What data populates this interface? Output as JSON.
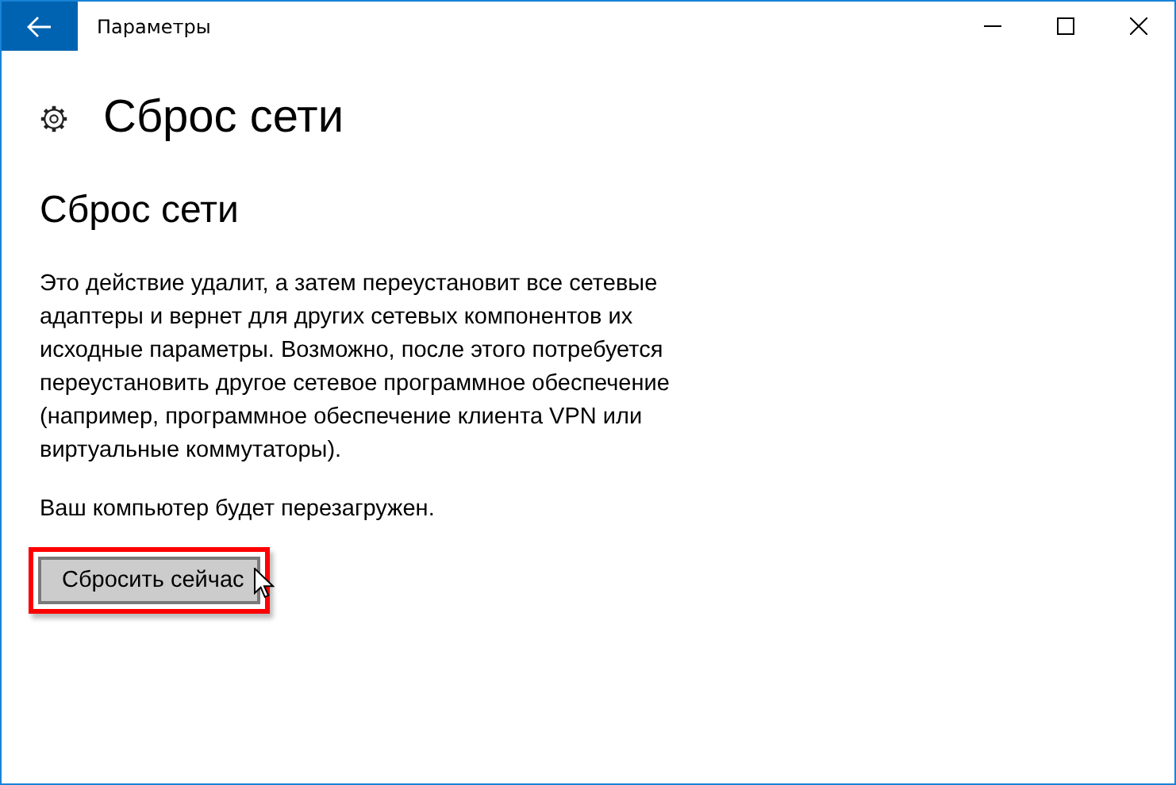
{
  "window": {
    "title": "Параметры"
  },
  "page": {
    "title": "Сброс сети"
  },
  "section": {
    "heading": "Сброс сети",
    "description": "Это действие удалит, а затем переустановит все сетевые адаптеры и вернет для других сетевых компонентов их исходные параметры. Возможно, после этого потребуется переустановить другое сетевое программное обеспечение (например, программное обеспечение клиента VPN или виртуальные коммутаторы).",
    "note": "Ваш компьютер будет перезагружен.",
    "button": {
      "label": "Сбросить сейчас",
      "highlighted": true
    }
  }
}
